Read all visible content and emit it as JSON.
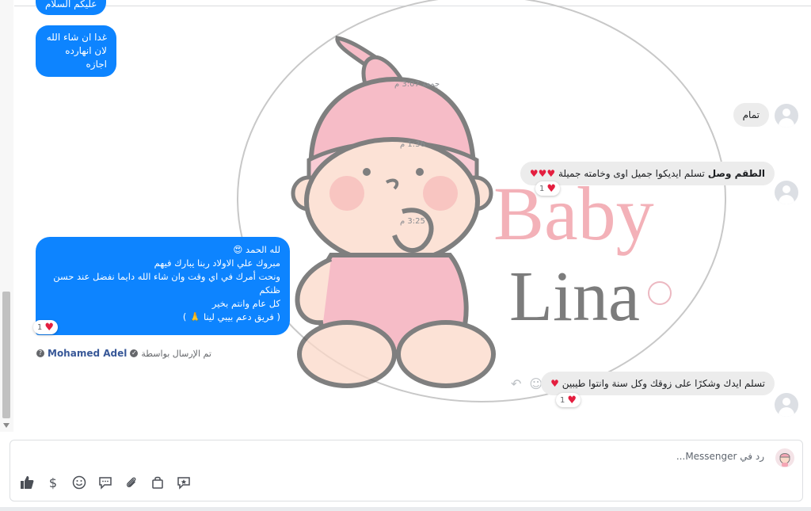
{
  "messages": {
    "out_top_partial": "عليكم السلام",
    "out_top_lines": [
      "غدا ان شاء الله",
      "لان انهارده اجازه"
    ],
    "time_1": "جمعة 3:07 م",
    "in_1": "تمام",
    "time_2": "1:36 م",
    "in_2_bold": "الطقم وصل",
    "in_2_rest": " تسلم ايديكوا جميل اوى وخامته جميلة",
    "in_2_hearts": "♥♥♥",
    "in_2_reaction_count": "1",
    "time_3": "3:25 م",
    "out_long_lines": [
      "لله الحمد 😍",
      "مبروك علي الاولاد ربنا يبارك فيهم",
      "ونحت أمرك في اي وقت وان شاء الله دايما نفضل عند حسن ظنكم",
      "كل عام وانتم بخير",
      "( فريق دعم بيبي لينا 🙏 )"
    ],
    "out_long_reaction_count": "1",
    "sent_by_label": "تم الإرسال بواسطة",
    "sent_by_name": "Mohamed Adel",
    "in_3": "تسلم ايدك وشكرًا على زوقك وكل سنة وانتوا طيبين",
    "in_3_heart": "♥",
    "in_3_reaction_count": "1"
  },
  "watermark": {
    "line1": "Baby",
    "line2": "Lina",
    "colors": {
      "baby": "#f2a9b0",
      "lina": "#6e6e6e",
      "hat": "#f4a6b5",
      "skin": "#fbd9c9",
      "outline": "#555555"
    }
  },
  "composer": {
    "placeholder": "رد في Messenger..."
  },
  "toolbar": {
    "icons": [
      "like-icon",
      "dollar-icon",
      "emoji-icon",
      "chat-bubble-icon",
      "attachment-icon",
      "shopping-bag-icon",
      "sticker-icon"
    ],
    "dollar_glyph": "$"
  },
  "colors": {
    "outgoing_bubble": "#0d84ff",
    "incoming_bubble": "#ececec",
    "heart": "#e41e3f",
    "link": "#385898"
  }
}
